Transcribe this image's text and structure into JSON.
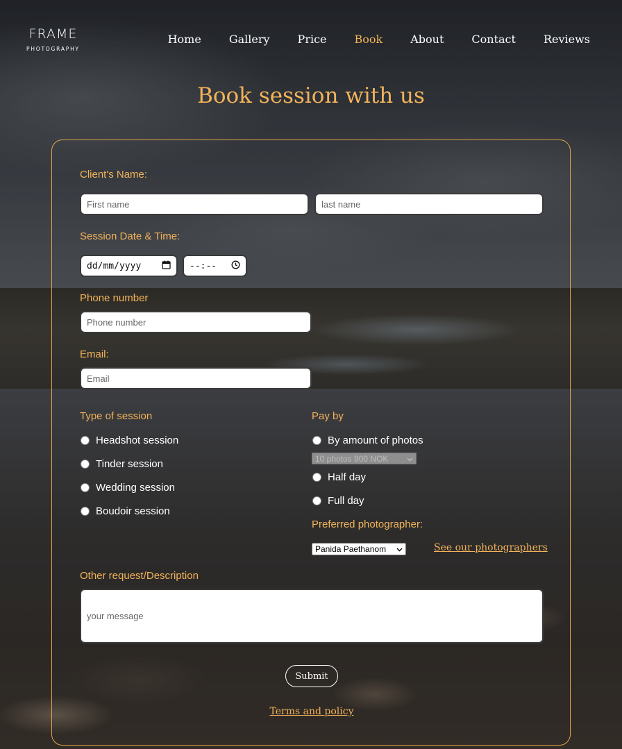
{
  "brand": {
    "name": "FRAME",
    "tagline": "PHOTOGRAPHY"
  },
  "nav": [
    "Home",
    "Gallery",
    "Price",
    "Book",
    "About",
    "Contact",
    "Reviews"
  ],
  "active_nav": "Book",
  "title": "Book session with us",
  "form": {
    "client_name_label": "Client's Name:",
    "first_name_placeholder": "First name",
    "last_name_placeholder": "last name",
    "session_label": "Session Date & Time:",
    "date_placeholder": "dd/mm/yyyy",
    "time_placeholder": "--:--",
    "phone_label": "Phone number",
    "phone_placeholder": "Phone number",
    "email_label": "Email:",
    "email_placeholder": "Email",
    "type_label": "Type of session",
    "types": [
      "Headshot session",
      "Tinder session",
      "Wedding session",
      "Boudoir session"
    ],
    "pay_label": "Pay by",
    "pay_option_photos": "By amount of photos",
    "photos_select": "10 photos 900 NOK",
    "pay_option_half": "Half day",
    "pay_option_full": "Full day",
    "photographer_label": "Preferred photographer:",
    "photographer_select": "Panida Paethanom",
    "see_photographers": "See our photographers",
    "request_label": "Other request/Description",
    "message_placeholder": "your message",
    "submit": "Submit",
    "terms": "Terms and policy"
  },
  "colors": {
    "accent": "#f2b35a",
    "text": "#ffffff"
  }
}
